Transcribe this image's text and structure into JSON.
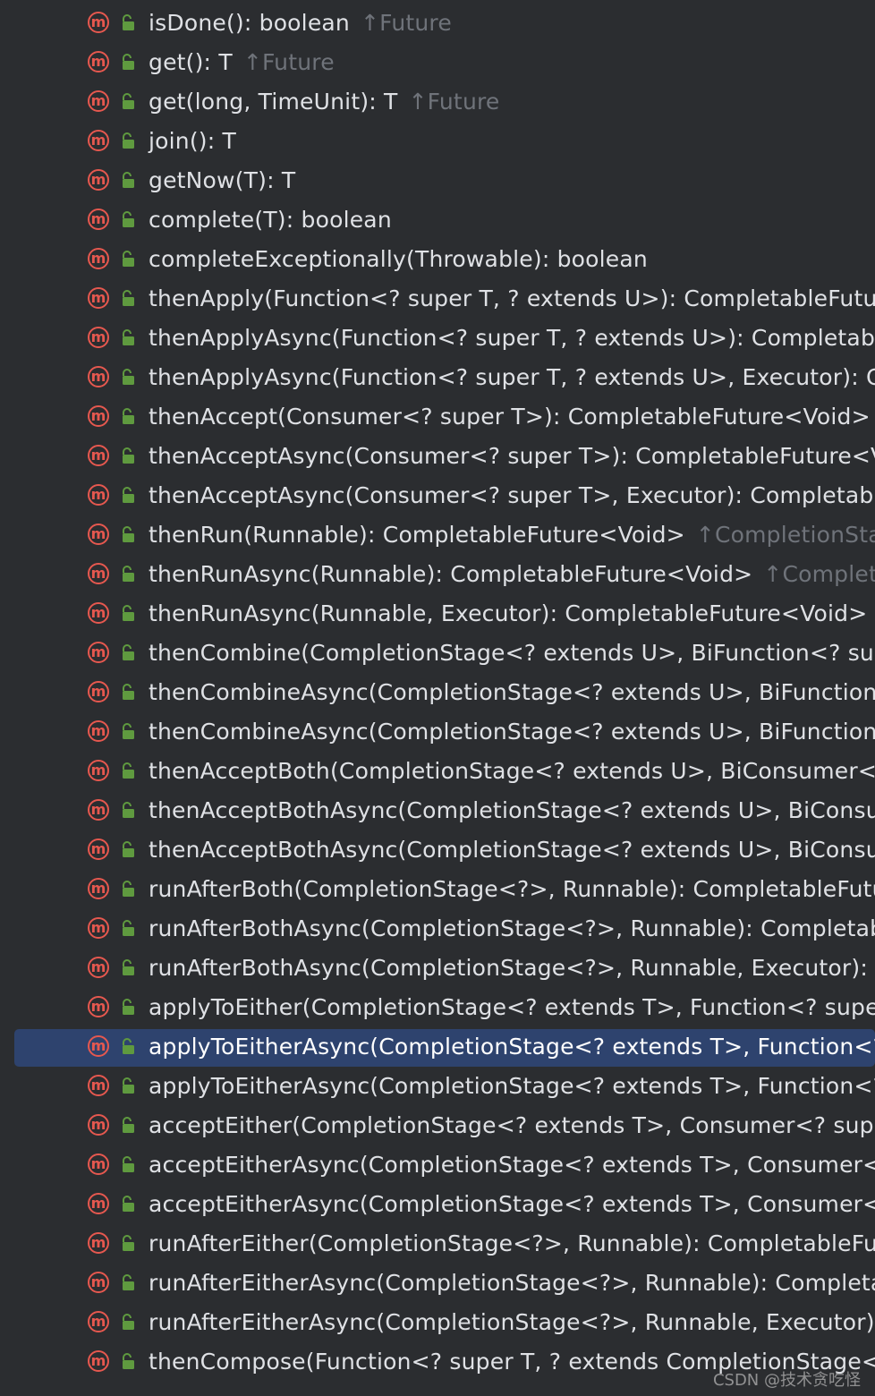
{
  "colors": {
    "background": "#2b2d30",
    "method_icon": "#e6584f",
    "lock_icon": "#5f9a3f",
    "text": "#dfe1e5",
    "owner_text": "#6f737a",
    "selection": "#2e436e"
  },
  "icons": {
    "method": "method-m-icon",
    "visibility": "public-lock-icon"
  },
  "methods": [
    {
      "signature": "isDone(): boolean",
      "owner": "↑Future"
    },
    {
      "signature": "get(): T",
      "owner": "↑Future"
    },
    {
      "signature": "get(long, TimeUnit): T",
      "owner": "↑Future"
    },
    {
      "signature": "join(): T",
      "owner": ""
    },
    {
      "signature": "getNow(T): T",
      "owner": ""
    },
    {
      "signature": "complete(T): boolean",
      "owner": ""
    },
    {
      "signature": "completeExceptionally(Throwable): boolean",
      "owner": ""
    },
    {
      "signature": "thenApply(Function<? super T, ? extends U>): CompletableFutur",
      "owner": ""
    },
    {
      "signature": "thenApplyAsync(Function<? super T, ? extends U>): Completable",
      "owner": ""
    },
    {
      "signature": "thenApplyAsync(Function<? super T, ? extends U>, Executor): Co",
      "owner": ""
    },
    {
      "signature": "thenAccept(Consumer<? super T>): CompletableFuture<Void>",
      "owner": "↑"
    },
    {
      "signature": "thenAcceptAsync(Consumer<? super T>): CompletableFuture<V",
      "owner": ""
    },
    {
      "signature": "thenAcceptAsync(Consumer<? super T>, Executor): Completable",
      "owner": ""
    },
    {
      "signature": "thenRun(Runnable): CompletableFuture<Void>",
      "owner": "↑CompletionStag"
    },
    {
      "signature": "thenRunAsync(Runnable): CompletableFuture<Void>",
      "owner": "↑Completio"
    },
    {
      "signature": "thenRunAsync(Runnable, Executor): CompletableFuture<Void>",
      "owner": "↑"
    },
    {
      "signature": "thenCombine(CompletionStage<? extends U>, BiFunction<? sup",
      "owner": ""
    },
    {
      "signature": "thenCombineAsync(CompletionStage<? extends U>, BiFunction<",
      "owner": ""
    },
    {
      "signature": "thenCombineAsync(CompletionStage<? extends U>, BiFunction<",
      "owner": ""
    },
    {
      "signature": "thenAcceptBoth(CompletionStage<? extends U>, BiConsumer<?",
      "owner": ""
    },
    {
      "signature": "thenAcceptBothAsync(CompletionStage<? extends U>, BiConsum",
      "owner": ""
    },
    {
      "signature": "thenAcceptBothAsync(CompletionStage<? extends U>, BiConsum",
      "owner": ""
    },
    {
      "signature": "runAfterBoth(CompletionStage<?>, Runnable): CompletableFutu",
      "owner": ""
    },
    {
      "signature": "runAfterBothAsync(CompletionStage<?>, Runnable): Completabl",
      "owner": ""
    },
    {
      "signature": "runAfterBothAsync(CompletionStage<?>, Runnable, Executor): C",
      "owner": ""
    },
    {
      "signature": "applyToEither(CompletionStage<? extends T>, Function<? super",
      "owner": ""
    },
    {
      "signature": "applyToEitherAsync(CompletionStage<? extends T>, Function<?",
      "owner": "",
      "selected": true
    },
    {
      "signature": "applyToEitherAsync(CompletionStage<? extends T>, Function<?",
      "owner": ""
    },
    {
      "signature": "acceptEither(CompletionStage<? extends T>, Consumer<? super",
      "owner": ""
    },
    {
      "signature": "acceptEitherAsync(CompletionStage<? extends T>, Consumer<?",
      "owner": ""
    },
    {
      "signature": "acceptEitherAsync(CompletionStage<? extends T>, Consumer<?",
      "owner": ""
    },
    {
      "signature": "runAfterEither(CompletionStage<?>, Runnable): CompletableFut",
      "owner": ""
    },
    {
      "signature": "runAfterEitherAsync(CompletionStage<?>, Runnable): Completal",
      "owner": ""
    },
    {
      "signature": "runAfterEitherAsync(CompletionStage<?>, Runnable, Executor):",
      "owner": ""
    },
    {
      "signature": "thenCompose(Function<? super T, ? extends CompletionStage<U",
      "owner": ""
    }
  ],
  "watermark": "CSDN @技术贪吃怪"
}
